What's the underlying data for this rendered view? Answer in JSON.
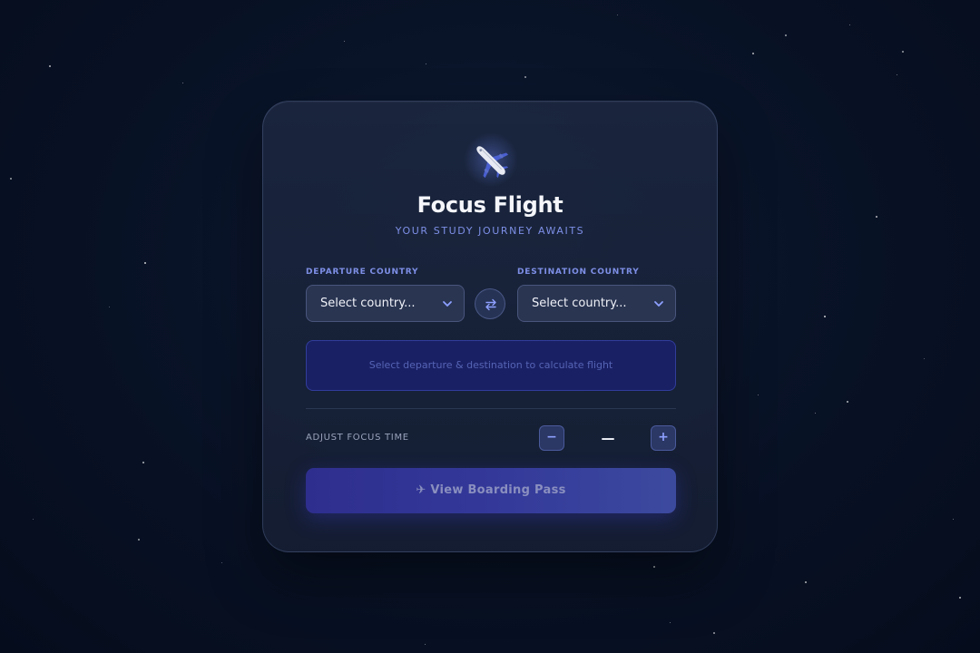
{
  "app": {
    "title": "Focus Flight",
    "subtitle": "YOUR STUDY JOURNEY AWAITS",
    "icon": "airplane-icon"
  },
  "departure": {
    "label": "DEPARTURE COUNTRY",
    "value": "Select country..."
  },
  "destination": {
    "label": "DESTINATION COUNTRY",
    "value": "Select country..."
  },
  "swap": {
    "icon": "swap-arrows-icon"
  },
  "flight_info": {
    "message": "Select departure & destination to calculate flight"
  },
  "focus_time": {
    "label": "ADJUST FOCUS TIME",
    "value": "—",
    "minus_label": "−",
    "plus_label": "+"
  },
  "cta": {
    "label": "✈ View Boarding Pass"
  },
  "colors": {
    "accent": "#7e8fe6",
    "background": "#091327",
    "card": "#1e2942",
    "button": "#343a9a"
  }
}
